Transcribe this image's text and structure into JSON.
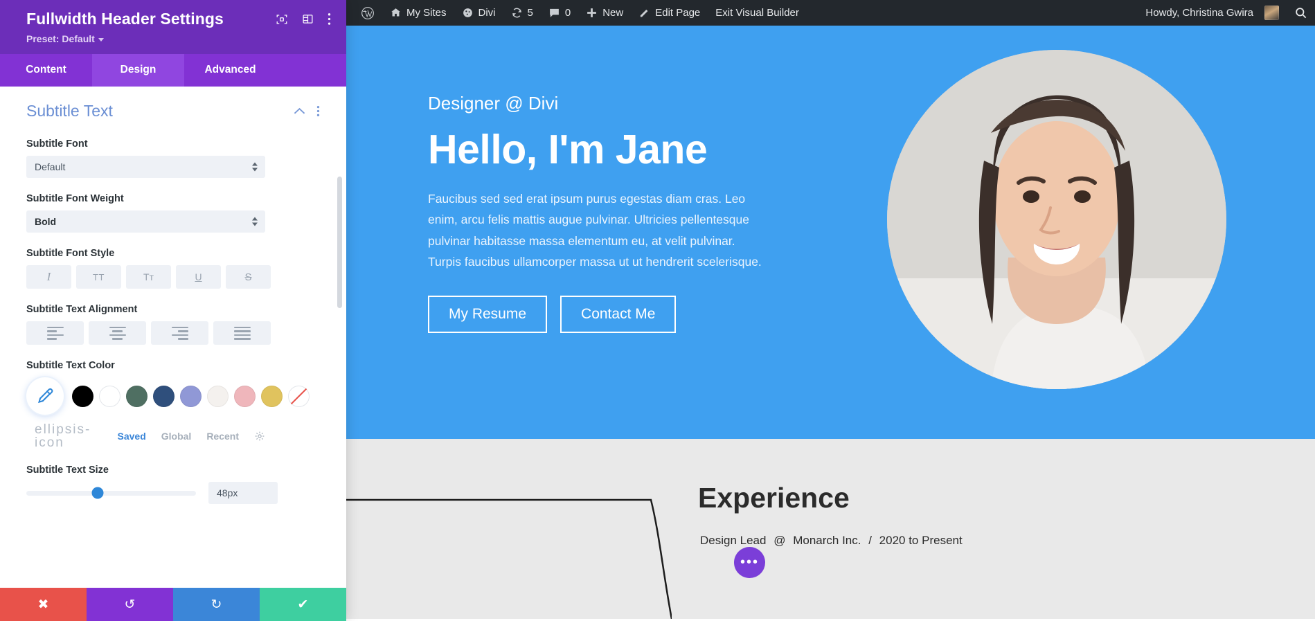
{
  "panel": {
    "title": "Fullwidth Header Settings",
    "preset_label": "Preset: Default",
    "icons": {
      "focus": "focus-target-icon",
      "layout": "layout-columns-icon",
      "more": "kebab-menu-icon"
    },
    "tabs": [
      {
        "label": "Content",
        "active": false
      },
      {
        "label": "Design",
        "active": true
      },
      {
        "label": "Advanced",
        "active": false
      }
    ],
    "section": {
      "title": "Subtitle Text"
    },
    "fields": {
      "font": {
        "label": "Subtitle Font",
        "value": "Default"
      },
      "font_weight": {
        "label": "Subtitle Font Weight",
        "value": "Bold"
      },
      "font_style": {
        "label": "Subtitle Font Style",
        "options": [
          "I",
          "TT",
          "Tᴛ",
          "U",
          "S"
        ]
      },
      "text_alignment": {
        "label": "Subtitle Text Alignment",
        "options": [
          "left",
          "center",
          "right",
          "justify"
        ]
      },
      "text_color": {
        "label": "Subtitle Text Color",
        "eyedropper": "eyedropper-icon",
        "swatches": [
          "#000000",
          "#ffffff",
          "#4f6f62",
          "#2f4f7c",
          "#9098d6",
          "#f4f1ee",
          "#efb6bb",
          "#e0c35e",
          "none"
        ],
        "tabs": [
          {
            "label": "Saved",
            "active": true
          },
          {
            "label": "Global",
            "active": false
          },
          {
            "label": "Recent",
            "active": false
          }
        ],
        "more": "ellipsis-icon",
        "settings": "gear-icon"
      },
      "text_size": {
        "label": "Subtitle Text Size",
        "value": "48px",
        "percent": 42
      }
    },
    "footer": [
      {
        "name": "cancel",
        "glyph": "✖",
        "color": "#e8524a"
      },
      {
        "name": "undo",
        "glyph": "↺",
        "color": "#8232d4"
      },
      {
        "name": "redo",
        "glyph": "↻",
        "color": "#3b86d8"
      },
      {
        "name": "save",
        "glyph": "✔",
        "color": "#3ecfa0"
      }
    ]
  },
  "adminbar": {
    "left_items": [
      {
        "label": "",
        "icon": "wordpress-logo-icon"
      },
      {
        "label": "My Sites",
        "icon": "sites-icon"
      },
      {
        "label": "Divi",
        "icon": "divi-icon"
      },
      {
        "label": "5",
        "icon": "updates-icon"
      },
      {
        "label": "0",
        "icon": "comments-icon"
      },
      {
        "label": "New",
        "icon": "plus-icon"
      },
      {
        "label": "Edit Page",
        "icon": "pencil-icon"
      },
      {
        "label": "Exit Visual Builder",
        "icon": ""
      }
    ],
    "howdy": "Howdy, Christina Gwira",
    "search_icon": "search-icon"
  },
  "hero": {
    "subtitle": "Designer @ Divi",
    "title": "Hello, I'm Jane",
    "body": "Faucibus sed sed erat ipsum purus egestas diam cras. Leo enim, arcu felis mattis augue pulvinar. Ultricies pellentesque pulvinar habitasse massa elementum eu, at velit pulvinar. Turpis faucibus ullamcorper massa ut ut hendrerit scelerisque.",
    "buttons": [
      {
        "label": "My Resume"
      },
      {
        "label": "Contact Me"
      }
    ],
    "background_color": "#3fa0f0",
    "photo_alt": "portrait-photo"
  },
  "experience": {
    "title": "Experience",
    "role": "Design Lead",
    "at": "@",
    "company": "Monarch Inc.",
    "sep": "/",
    "dates": "2020 to Present",
    "module_button": "•••"
  }
}
